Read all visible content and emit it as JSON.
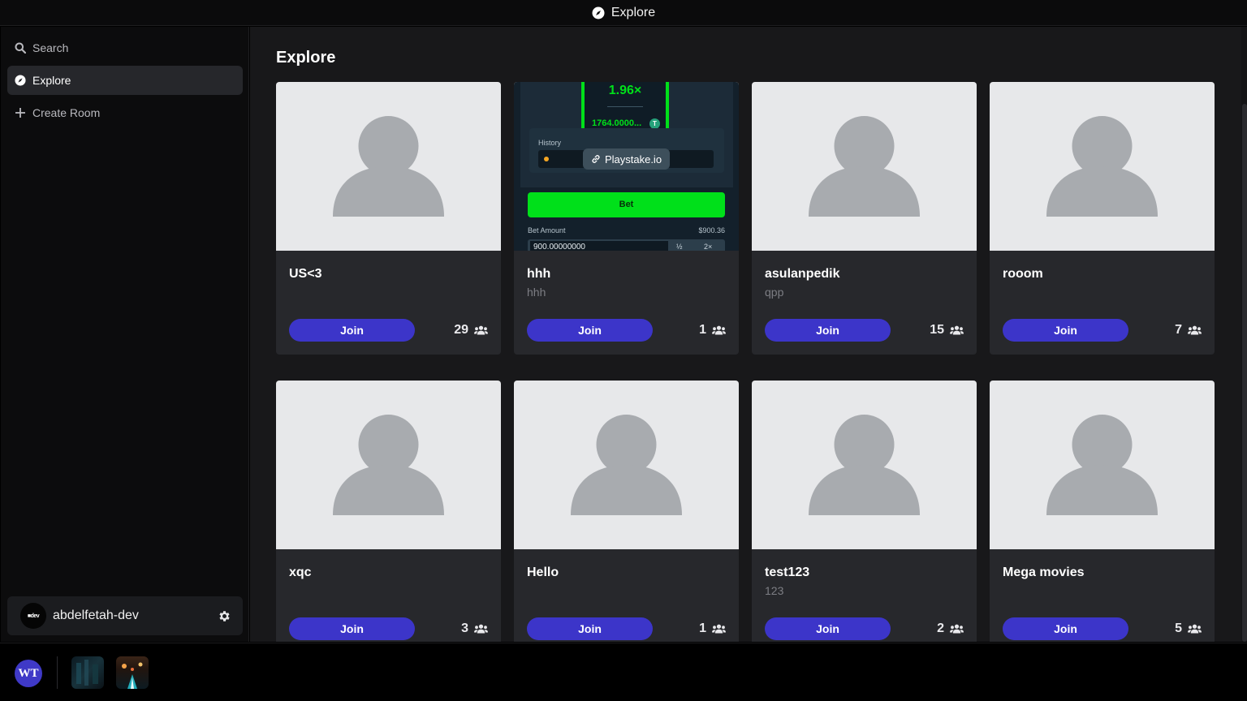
{
  "window": {
    "title": "Explore"
  },
  "sidebar": {
    "items": [
      {
        "label": "Search",
        "icon": "search-icon"
      },
      {
        "label": "Explore",
        "icon": "compass-icon"
      },
      {
        "label": "Create Room",
        "icon": "plus-icon"
      }
    ],
    "user": {
      "name": "abdelfetah-dev",
      "avatar_text": "■dev"
    }
  },
  "main": {
    "title": "Explore",
    "rooms": [
      {
        "name": "US<3",
        "description": "",
        "members": "29",
        "join_label": "Join",
        "thumbnail": "default-avatar"
      },
      {
        "name": "hhh",
        "description": "hhh",
        "members": "1",
        "join_label": "Join",
        "thumbnail": "screenshot",
        "preview": {
          "multiplier": "1.96×",
          "balance": "1764.0000...",
          "history_label": "History",
          "link_label": "Playstake.io",
          "bet_label": "Bet",
          "bet_amount_label": "Bet Amount",
          "bet_amount_value": "$900.36",
          "input_value": "900.00000000",
          "half_label": "½",
          "double_label": "2×"
        }
      },
      {
        "name": "asulanpedik",
        "description": "qpp",
        "members": "15",
        "join_label": "Join",
        "thumbnail": "default-avatar"
      },
      {
        "name": "rooom",
        "description": "",
        "members": "7",
        "join_label": "Join",
        "thumbnail": "default-avatar"
      },
      {
        "name": "xqc",
        "description": "",
        "members": "3",
        "join_label": "Join",
        "thumbnail": "default-avatar"
      },
      {
        "name": "Hello",
        "description": "",
        "members": "1",
        "join_label": "Join",
        "thumbnail": "default-avatar"
      },
      {
        "name": "test123",
        "description": "123",
        "members": "2",
        "join_label": "Join",
        "thumbnail": "default-avatar"
      },
      {
        "name": "Mega movies",
        "description": "",
        "members": "5",
        "join_label": "Join",
        "thumbnail": "default-avatar"
      }
    ]
  },
  "taskbar": {
    "logo_text": "WT"
  },
  "colors": {
    "accent": "#3c35c9",
    "card_bg": "#27282c",
    "main_bg": "#18181a",
    "sidebar_bg": "#0c0c0d",
    "bet_green": "#00e01a"
  }
}
